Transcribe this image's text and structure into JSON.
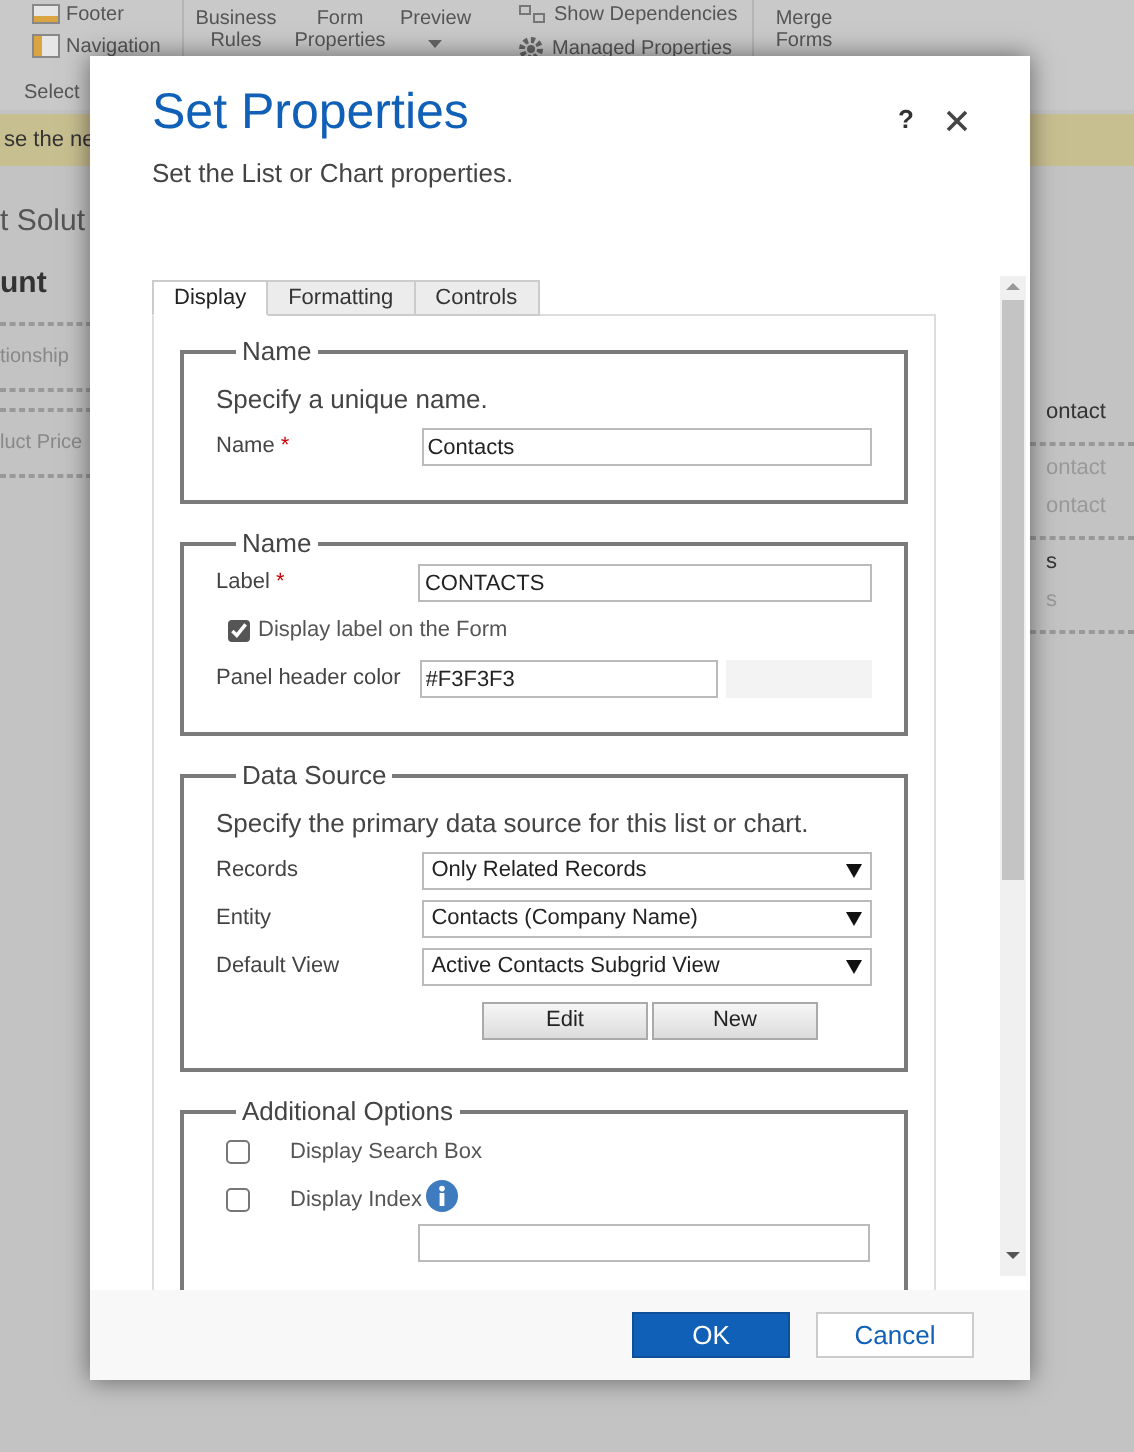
{
  "background": {
    "ribbon": {
      "footer": "Footer",
      "navigation": "Navigation",
      "select": "Select",
      "business_rules": "Business Rules",
      "form_properties": "Form Properties",
      "preview": "Preview",
      "show_dependencies": "Show Dependencies",
      "managed_properties": "Managed Properties",
      "merge_forms": "Merge Forms"
    },
    "notification": "se the ne",
    "page_title": "t Solut",
    "entity_name": "unt",
    "left_items": [
      "tionship",
      "luct Price"
    ],
    "right_items": [
      {
        "label": "ontact",
        "disabled": false
      },
      {
        "label": "ontact",
        "disabled": true
      },
      {
        "label": "ontact",
        "disabled": true
      },
      {
        "label": "s",
        "disabled": false
      },
      {
        "label": "s",
        "disabled": true
      }
    ]
  },
  "dialog": {
    "title": "Set Properties",
    "subtitle": "Set the List or Chart properties.",
    "help": "?",
    "tabs": [
      {
        "label": "Display",
        "selected": true
      },
      {
        "label": "Formatting",
        "selected": false
      },
      {
        "label": "Controls",
        "selected": false
      }
    ],
    "sections": [
      {
        "legend": "Name",
        "rows": [
          {
            "kind": "description",
            "text": "Specify a unique name."
          },
          {
            "kind": "text",
            "label": "Name",
            "required_mark": "*",
            "value": "Contacts"
          }
        ]
      },
      {
        "legend": "Name",
        "rows": [
          {
            "kind": "text",
            "label": "Label",
            "required_mark": "*",
            "value": "CONTACTS"
          },
          {
            "kind": "checkbox",
            "label": "Display label on the Form",
            "checked": true
          },
          {
            "kind": "color",
            "label": "Panel header color",
            "value": "#F3F3F3"
          }
        ]
      },
      {
        "legend": "Data Source",
        "rows": [
          {
            "kind": "description",
            "text": "Specify the primary data source for this list or chart."
          },
          {
            "kind": "select",
            "label": "Records",
            "value": "Only Related Records"
          },
          {
            "kind": "select",
            "label": "Entity",
            "value": "Contacts (Company Name)"
          },
          {
            "kind": "select",
            "label": "Default View",
            "value": "Active Contacts Subgrid View"
          },
          {
            "kind": "buttons",
            "buttons": [
              "Edit",
              "New"
            ]
          }
        ]
      },
      {
        "legend": "Additional Options",
        "rows": [
          {
            "kind": "option",
            "label": "Display Search Box",
            "checked": false,
            "info": false
          },
          {
            "kind": "option",
            "label": "Display Index",
            "checked": false,
            "info": true
          },
          {
            "kind": "field"
          }
        ]
      }
    ],
    "buttons": [
      {
        "label": "OK",
        "primary": true
      },
      {
        "label": "Cancel",
        "primary": false
      }
    ]
  }
}
